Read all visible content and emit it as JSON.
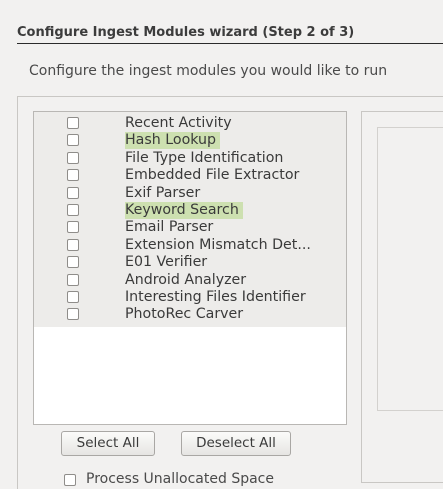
{
  "wizard": {
    "title": "Configure Ingest Modules wizard (Step 2 of 3)",
    "subtitle": "Configure the ingest modules you would like to run"
  },
  "modules": [
    {
      "label": "Recent Activity",
      "checked": false,
      "highlighted": false
    },
    {
      "label": "Hash Lookup",
      "checked": false,
      "highlighted": true
    },
    {
      "label": "File Type Identification",
      "checked": false,
      "highlighted": false
    },
    {
      "label": "Embedded File Extractor",
      "checked": false,
      "highlighted": false
    },
    {
      "label": "Exif Parser",
      "checked": false,
      "highlighted": false
    },
    {
      "label": "Keyword Search",
      "checked": false,
      "highlighted": true
    },
    {
      "label": "Email Parser",
      "checked": false,
      "highlighted": false
    },
    {
      "label": "Extension Mismatch Det...",
      "checked": false,
      "highlighted": false
    },
    {
      "label": "E01 Verifier",
      "checked": false,
      "highlighted": false
    },
    {
      "label": "Android Analyzer",
      "checked": false,
      "highlighted": false
    },
    {
      "label": "Interesting Files Identifier",
      "checked": false,
      "highlighted": false
    },
    {
      "label": "PhotoRec Carver",
      "checked": false,
      "highlighted": false
    }
  ],
  "buttons": {
    "select_all": "Select All",
    "deselect_all": "Deselect All"
  },
  "options": {
    "process_unallocated_label": "Process Unallocated Space",
    "process_unallocated_checked": false
  },
  "colors": {
    "highlight": "#cde0b0",
    "panel_background": "#f2f1f0"
  }
}
